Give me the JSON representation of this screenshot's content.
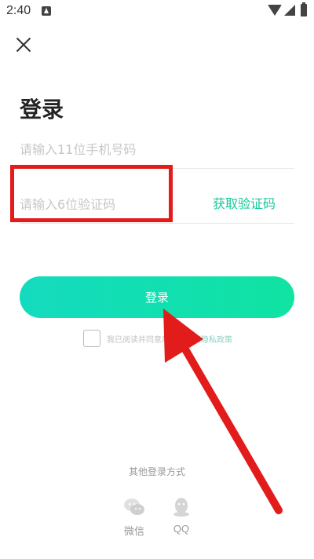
{
  "status_bar": {
    "time": "2:40"
  },
  "page": {
    "title": "登录"
  },
  "form": {
    "phone_placeholder": "请输入11位手机号码",
    "code_placeholder": "请输入6位验证码",
    "get_code_label": "获取验证码",
    "login_label": "登录",
    "agreement_prefix": "我已阅读并同意",
    "agreement_link_a": "用户协议",
    "agreement_sep": "和",
    "agreement_link_b": "隐私政策"
  },
  "other_login": {
    "title": "其他登录方式",
    "options": [
      {
        "label": "微信",
        "icon": "wechat-icon"
      },
      {
        "label": "QQ",
        "icon": "qq-icon"
      }
    ]
  },
  "colors": {
    "accent": "#15c89b",
    "gradient_start": "#14dbbf",
    "gradient_end": "#10e3a2",
    "annotation": "#e21b1b"
  }
}
